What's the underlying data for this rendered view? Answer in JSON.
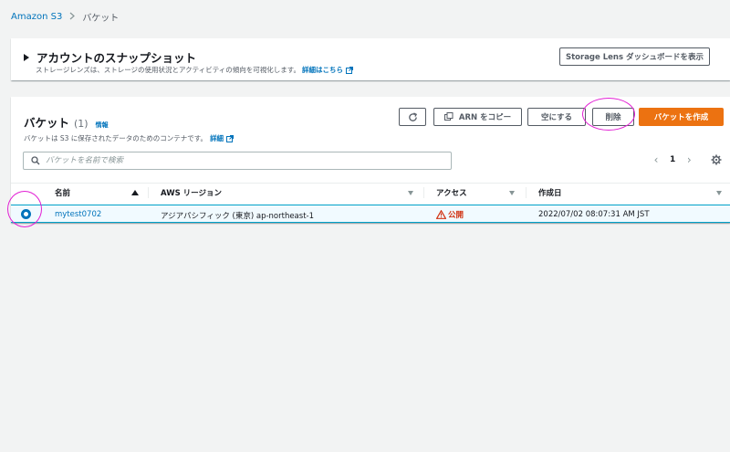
{
  "breadcrumb": {
    "root": "Amazon S3",
    "current": "バケット"
  },
  "account": {
    "title": "アカウントのスナップショット",
    "description": "ストレージレンズは、ストレージの使用状況とアクティビティの傾向を可視化します。",
    "details_link": "詳細はこちら",
    "lens_button": "Storage Lens ダッシュボードを表示"
  },
  "buckets": {
    "title": "バケット",
    "count": "(1)",
    "info": "情報",
    "description": "バケットは S3 に保存されたデータのためのコンテナです。",
    "details_link": "詳細",
    "buttons": {
      "arn": "ARN をコピー",
      "empty": "空にする",
      "delete": "削除",
      "create": "バケットを作成"
    },
    "search_placeholder": "バケットを名前で検索",
    "page": "1",
    "columns": {
      "name": "名前",
      "region": "AWS リージョン",
      "access": "アクセス",
      "created": "作成日"
    },
    "rows": [
      {
        "name": "mytest0702",
        "region": "アジアパシフィック (東京) ap-northeast-1",
        "access": "公開",
        "created": "2022/07/02 08:07:31 AM JST",
        "selected": true
      }
    ]
  },
  "colors": {
    "link": "#0073bb",
    "primary": "#ec7211",
    "warning": "#d13212",
    "annotation": "#e21fd4"
  },
  "icons": [
    "chevron-right-icon",
    "caret-right-icon",
    "external-link-icon",
    "refresh-icon",
    "copy-icon",
    "search-icon",
    "chevron-left-icon",
    "gear-icon",
    "sort-ascending-icon",
    "sort-descending-icon",
    "warning-icon",
    "radio-selected-icon"
  ]
}
